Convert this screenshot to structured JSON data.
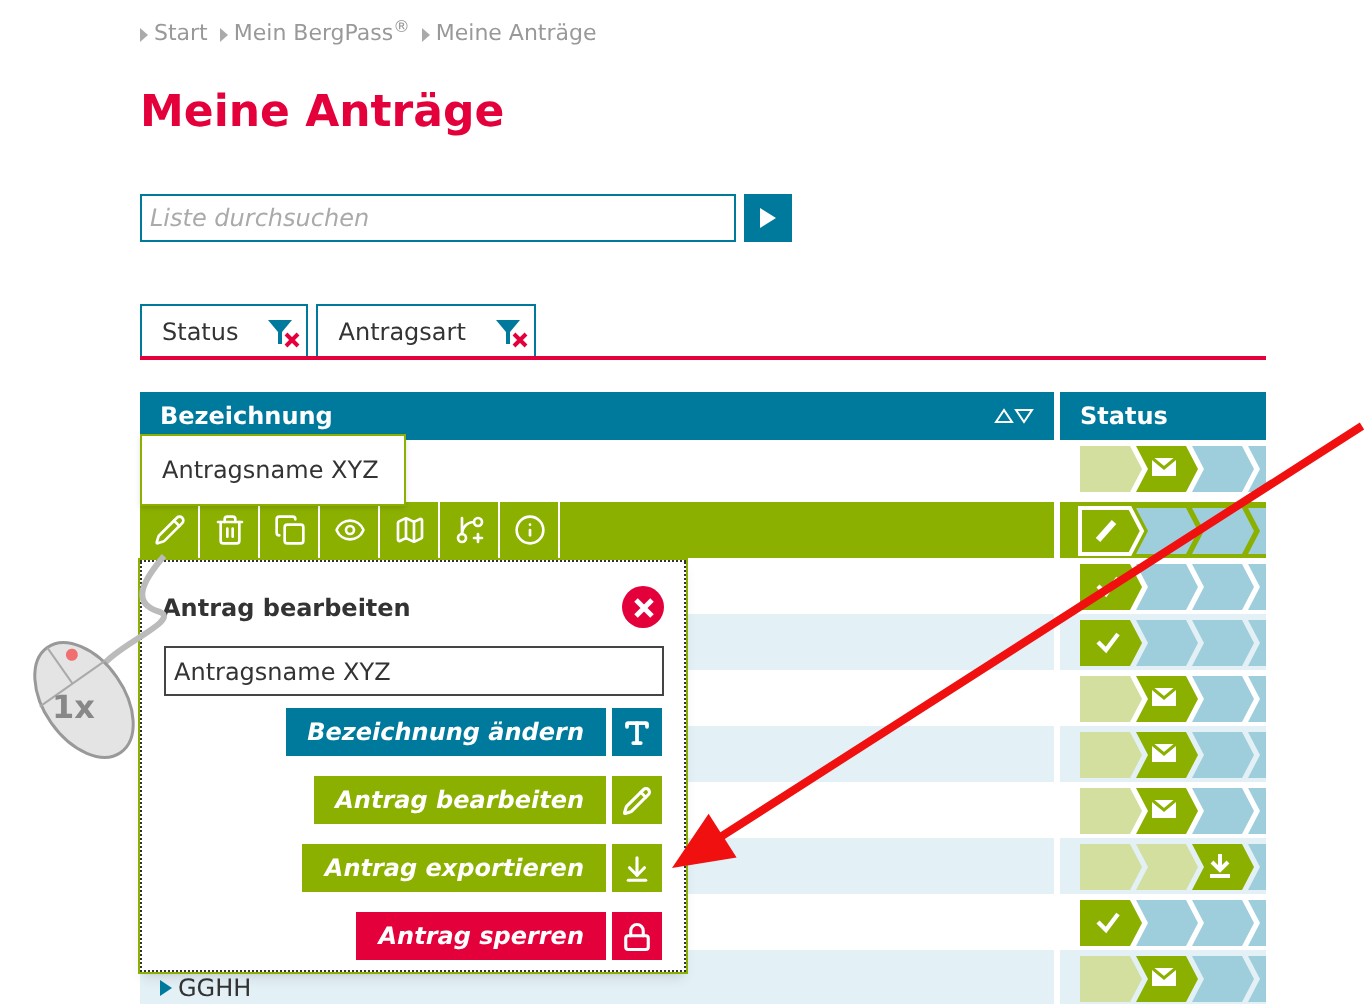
{
  "breadcrumb": [
    {
      "label": "Start"
    },
    {
      "label": "Mein BergPass$^{®}$"
    },
    {
      "label": "Meine Anträge"
    }
  ],
  "title": "Meine Anträge",
  "search": {
    "placeholder": "Liste durchsuchen"
  },
  "filters": [
    {
      "label": "Status"
    },
    {
      "label": "Antragsart"
    }
  ],
  "table": {
    "columns": [
      "Bezeichnung",
      "Status"
    ],
    "rows": [
      {
        "selected": false,
        "steps": [
          {
            "kind": "done"
          },
          {
            "kind": "mail"
          },
          {
            "kind": "open"
          },
          {
            "kind": "open"
          }
        ]
      },
      {
        "selected": true,
        "steps": [
          {
            "kind": "edit"
          },
          {
            "kind": "open"
          },
          {
            "kind": "open"
          },
          {
            "kind": "open"
          }
        ]
      },
      {
        "selected": false,
        "steps": [
          {
            "kind": "check"
          },
          {
            "kind": "open"
          },
          {
            "kind": "open"
          },
          {
            "kind": "open"
          }
        ]
      },
      {
        "selected": false,
        "steps": [
          {
            "kind": "check"
          },
          {
            "kind": "open"
          },
          {
            "kind": "open"
          },
          {
            "kind": "open"
          }
        ]
      },
      {
        "selected": false,
        "steps": [
          {
            "kind": "done"
          },
          {
            "kind": "mail"
          },
          {
            "kind": "open"
          },
          {
            "kind": "open"
          }
        ]
      },
      {
        "selected": false,
        "steps": [
          {
            "kind": "done"
          },
          {
            "kind": "mail"
          },
          {
            "kind": "open"
          },
          {
            "kind": "open"
          }
        ]
      },
      {
        "selected": false,
        "steps": [
          {
            "kind": "done"
          },
          {
            "kind": "mail"
          },
          {
            "kind": "open"
          },
          {
            "kind": "open"
          }
        ]
      },
      {
        "selected": false,
        "steps": [
          {
            "kind": "done"
          },
          {
            "kind": "done"
          },
          {
            "kind": "download"
          },
          {
            "kind": "open"
          }
        ]
      },
      {
        "selected": false,
        "steps": [
          {
            "kind": "check"
          },
          {
            "kind": "open"
          },
          {
            "kind": "open"
          },
          {
            "kind": "open"
          }
        ]
      },
      {
        "selected": false,
        "name": "GGHH",
        "steps": [
          {
            "kind": "done"
          },
          {
            "kind": "mail"
          },
          {
            "kind": "open"
          },
          {
            "kind": "open"
          }
        ]
      }
    ]
  },
  "tooltip": "Antragsname XYZ",
  "popup": {
    "title": "Antrag bearbeiten",
    "value": "Antragsname XYZ",
    "actions": [
      {
        "label": "Bezeichnung ändern",
        "color": "#007a9c",
        "kind": "rename"
      },
      {
        "label": "Antrag bearbeiten",
        "color": "#8cb000",
        "kind": "edit"
      },
      {
        "label": "Antrag exportieren",
        "color": "#8cb000",
        "kind": "export"
      },
      {
        "label": "Antrag sperren",
        "color": "#e4003a",
        "kind": "lock"
      }
    ]
  },
  "click_hint": "1x"
}
